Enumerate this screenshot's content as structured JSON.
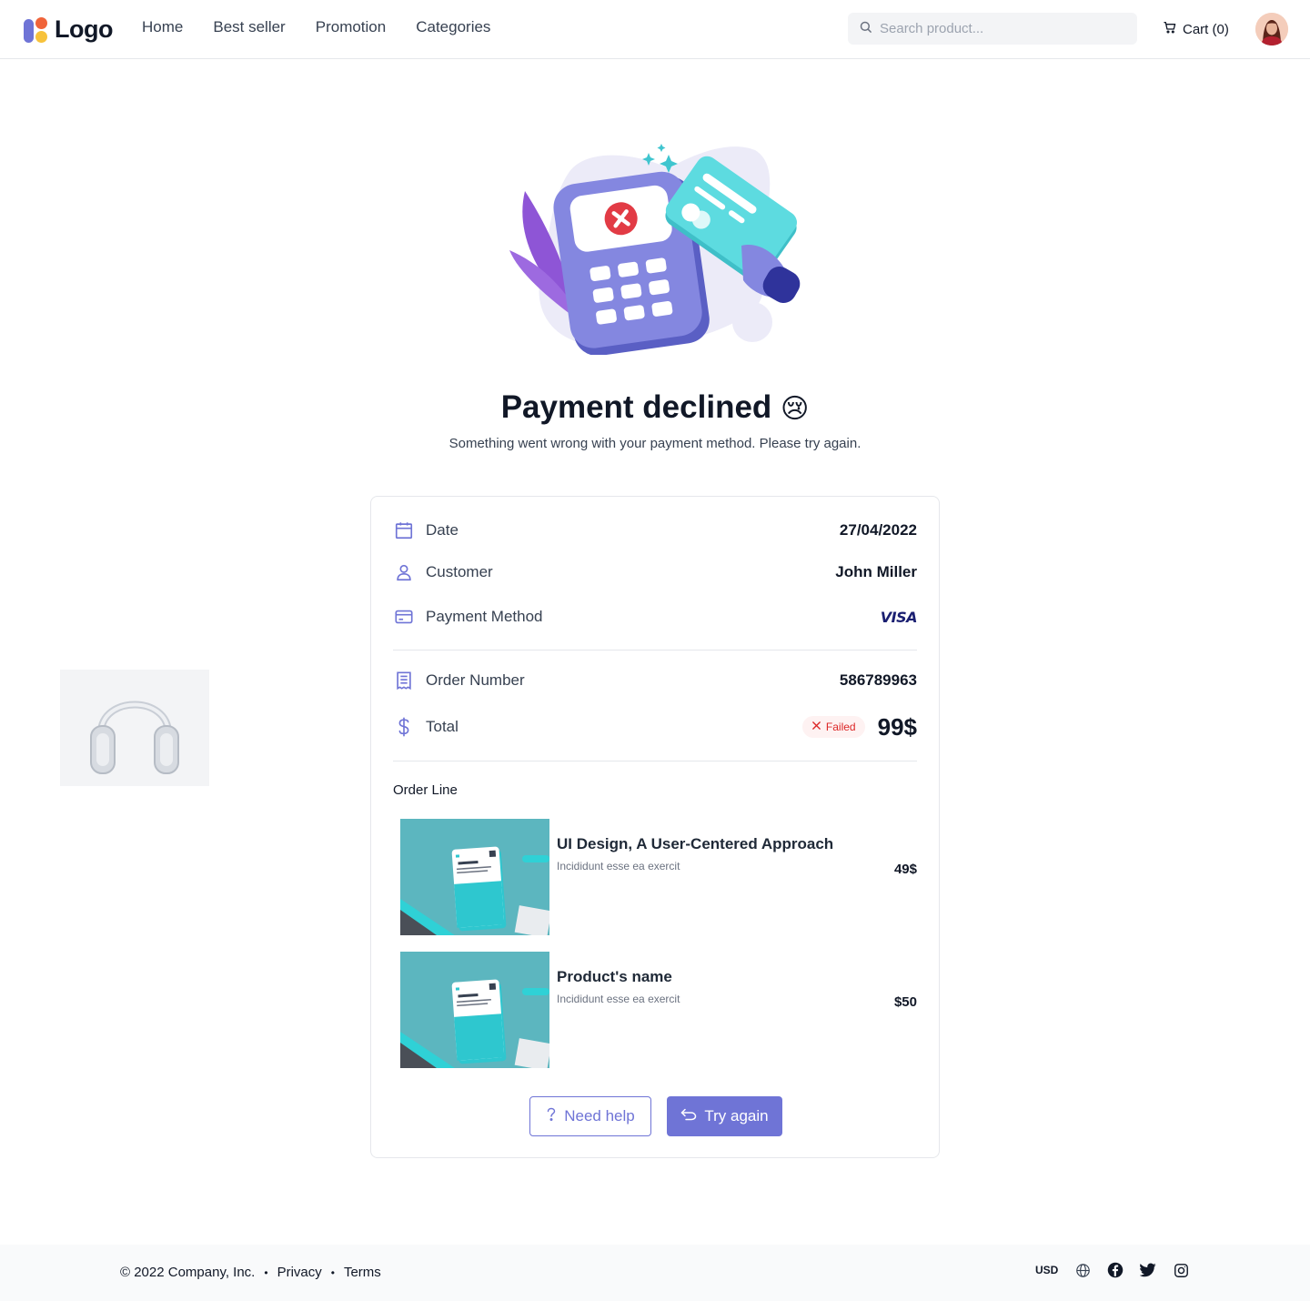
{
  "header": {
    "logo_text": "Logo",
    "nav": [
      {
        "label": "Home"
      },
      {
        "label": "Best seller"
      },
      {
        "label": "Promotion"
      },
      {
        "label": "Categories"
      }
    ],
    "search": {
      "placeholder": "Search product...",
      "value": ""
    },
    "cart_label": "Cart (0)"
  },
  "hero": {
    "title": "Payment declined",
    "title_emoji": "😢",
    "subtitle": "Something went wrong with your payment method. Please try again."
  },
  "summary": {
    "date": {
      "label": "Date",
      "value": "27/04/2022",
      "icon": "calendar-icon"
    },
    "customer": {
      "label": "Customer",
      "value": "John Miller",
      "icon": "user-icon"
    },
    "payment_method": {
      "label": "Payment Method",
      "value": "VISA",
      "icon": "credit-card-icon"
    },
    "order_number": {
      "label": "Order Number",
      "value": "586789963",
      "icon": "receipt-icon"
    },
    "total": {
      "label": "Total",
      "value": "99$",
      "status": "Failed",
      "icon": "dollar-icon"
    }
  },
  "order_line": {
    "title": "Order Line",
    "items": [
      {
        "name": "UI Design, A User-Centered Approach",
        "description": "Incididunt esse ea exercit",
        "price": "49$"
      },
      {
        "name": "Product's name",
        "description": "Incididunt esse ea exercit",
        "price": "$50"
      }
    ]
  },
  "actions": {
    "help_label": "Need help",
    "retry_label": "Try again"
  },
  "footer": {
    "copyright": "© 2022 Company, Inc.",
    "links": [
      {
        "label": "Privacy"
      },
      {
        "label": "Terms"
      }
    ],
    "currency": "USD",
    "social_icons": [
      "globe-icon",
      "facebook-icon",
      "twitter-icon",
      "instagram-icon"
    ]
  },
  "colors": {
    "accent": "#6f74d6",
    "failed": "#dc2626",
    "failed_bg": "#fef2f2",
    "visa": "#1a1f71"
  }
}
